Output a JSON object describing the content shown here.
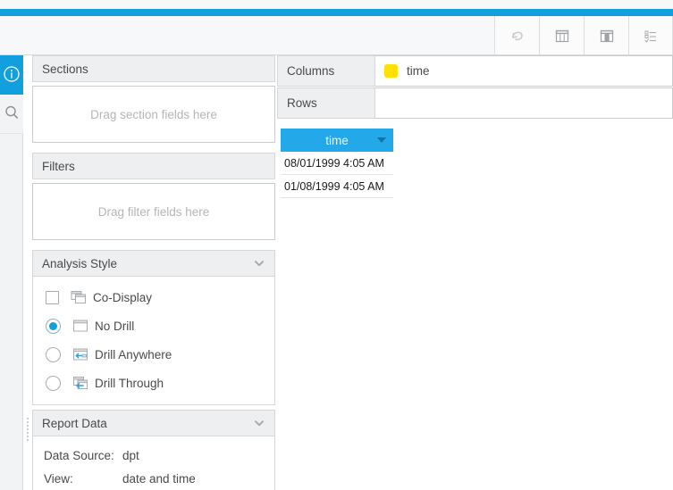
{
  "theme": {
    "brand_blue": "#129fdd",
    "grid_header_blue": "#23a9ea",
    "chip_yellow": "#ffe000",
    "panel_grey": "#eeeff0"
  },
  "toolbar": {
    "buttons": [
      {
        "name": "undo-icon",
        "label": "Undo",
        "disabled": true
      },
      {
        "name": "table-icon",
        "label": "Table",
        "disabled": false
      },
      {
        "name": "crosstab-icon",
        "label": "Crosstab",
        "disabled": false
      },
      {
        "name": "list-icon",
        "label": "List",
        "disabled": false
      }
    ]
  },
  "rail": {
    "items": [
      {
        "name": "info-icon",
        "label": "Info",
        "active": true
      },
      {
        "name": "search-icon",
        "label": "Search",
        "active": false
      }
    ]
  },
  "sections_panel": {
    "title": "Sections",
    "placeholder": "Drag section fields here"
  },
  "filters_panel": {
    "title": "Filters",
    "placeholder": "Drag filter fields here"
  },
  "analysis_style": {
    "title": "Analysis Style",
    "options": [
      {
        "label": "Co-Display",
        "control": "checkbox",
        "checked": false,
        "icon": "co-display-icon"
      },
      {
        "label": "No Drill",
        "control": "radio",
        "checked": true,
        "icon": "no-drill-icon"
      },
      {
        "label": "Drill Anywhere",
        "control": "radio",
        "checked": false,
        "icon": "drill-anywhere-icon"
      },
      {
        "label": "Drill Through",
        "control": "radio",
        "checked": false,
        "icon": "drill-through-icon"
      }
    ]
  },
  "report_data": {
    "title": "Report Data",
    "rows": [
      {
        "key": "Data Source:",
        "value": "dpt"
      },
      {
        "key": "View:",
        "value": "date and time"
      }
    ]
  },
  "shelves": [
    {
      "label": "Columns",
      "chip": "time",
      "chip_color": "#ffe000"
    },
    {
      "label": "Rows",
      "chip": "",
      "chip_color": ""
    }
  ],
  "data_grid": {
    "header": "time",
    "rows": [
      "08/01/1999 4:05 AM",
      "01/08/1999 4:05 AM"
    ]
  }
}
